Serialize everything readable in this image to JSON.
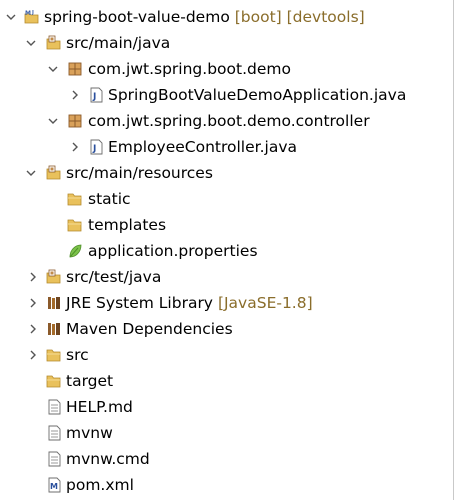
{
  "colors": {
    "decoration": "#8a6d2b",
    "twistie": "#555555",
    "folder": "#e9c15c",
    "package": "#a56b2a",
    "jar": "#8b5a2b"
  },
  "project": {
    "name": "spring-boot-value-demo",
    "decoration": "[boot] [devtools]",
    "icon": "maven-project-icon",
    "expanded": true
  },
  "tree": {
    "src_main_java": {
      "label": "src/main/java",
      "icon": "source-folder-icon",
      "expanded": true,
      "packages": [
        {
          "label": "com.jwt.spring.boot.demo",
          "icon": "package-icon",
          "expanded": true,
          "files": [
            {
              "label": "SpringBootValueDemoApplication.java",
              "icon": "java-file-icon"
            }
          ]
        },
        {
          "label": "com.jwt.spring.boot.demo.controller",
          "icon": "package-icon",
          "expanded": true,
          "files": [
            {
              "label": "EmployeeController.java",
              "icon": "java-file-icon"
            }
          ]
        }
      ]
    },
    "src_main_resources": {
      "label": "src/main/resources",
      "icon": "source-folder-icon",
      "expanded": true,
      "children": [
        {
          "label": "static",
          "icon": "folder-icon"
        },
        {
          "label": "templates",
          "icon": "folder-icon"
        },
        {
          "label": "application.properties",
          "icon": "spring-properties-icon"
        }
      ]
    },
    "src_test_java": {
      "label": "src/test/java",
      "icon": "source-folder-icon",
      "expanded": false
    },
    "jre": {
      "label": "JRE System Library",
      "decoration": "[JavaSE-1.8]",
      "icon": "library-icon",
      "expanded": false
    },
    "maven": {
      "label": "Maven Dependencies",
      "icon": "library-icon",
      "expanded": false
    },
    "src": {
      "label": "src",
      "icon": "folder-icon",
      "expanded": false
    },
    "target": {
      "label": "target",
      "icon": "folder-icon"
    },
    "files": [
      {
        "label": "HELP.md",
        "icon": "text-file-icon"
      },
      {
        "label": "mvnw",
        "icon": "text-file-icon"
      },
      {
        "label": "mvnw.cmd",
        "icon": "text-file-icon"
      },
      {
        "label": "pom.xml",
        "icon": "maven-pom-icon"
      }
    ]
  }
}
